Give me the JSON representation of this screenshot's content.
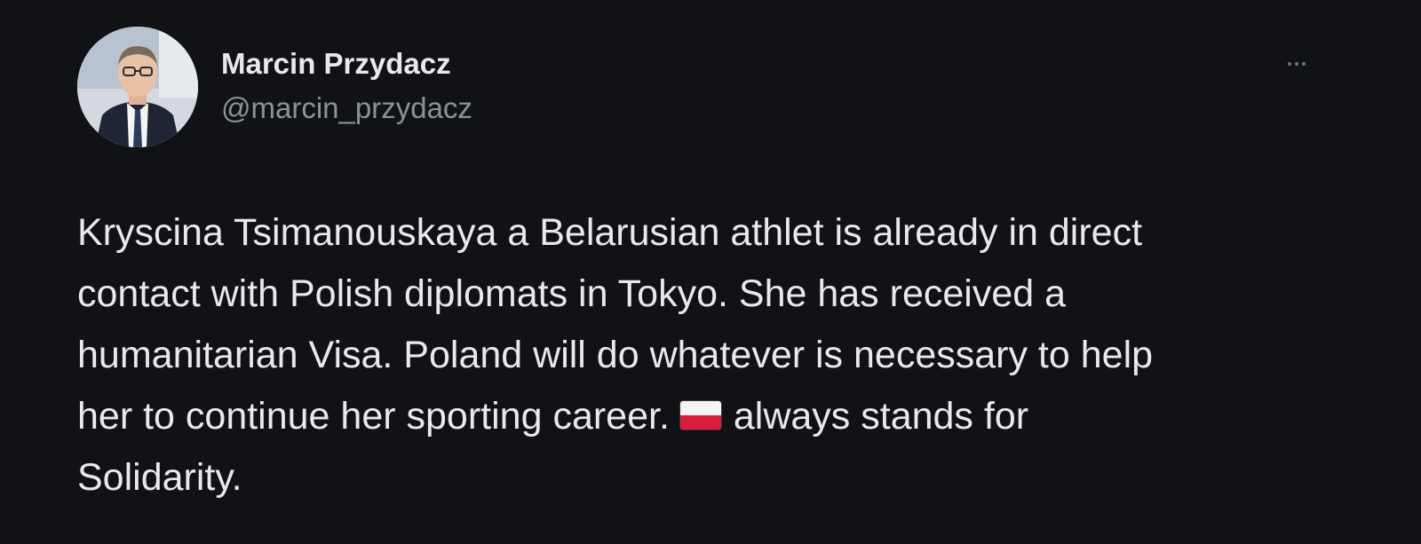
{
  "author": {
    "display_name": "Marcin Przydacz",
    "handle": "@marcin_przydacz"
  },
  "tweet": {
    "lines": [
      "Kryscina Tsimanouskaya a Belarusian athlet is already in direct",
      "contact with Polish diplomats in Tokyo. She has received a",
      "humanitarian Visa. Poland will do whatever is necessary to help",
      "her to continue her sporting career. ",
      "always stands for",
      "Solidarity."
    ],
    "emoji": "flag-poland"
  },
  "colors": {
    "background": "#101216",
    "text": "#e7e9ea",
    "secondary_text": "#8b9299"
  },
  "icons": {
    "more": "more-options-icon",
    "emoji_flag": "poland-flag-icon"
  }
}
